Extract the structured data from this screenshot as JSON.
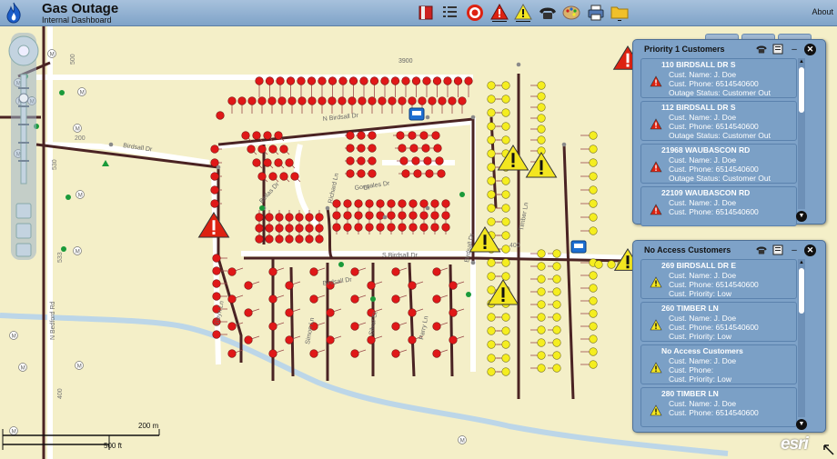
{
  "header": {
    "title": "Gas Outage",
    "subtitle": "Internal Dashboard",
    "about_label": "About"
  },
  "toolbar": [
    {
      "name": "layers-book-icon"
    },
    {
      "name": "list-icon"
    },
    {
      "name": "target-icon"
    },
    {
      "name": "red-alert-icon"
    },
    {
      "name": "yellow-alert-icon"
    },
    {
      "name": "phone-icon"
    },
    {
      "name": "palette-icon"
    },
    {
      "name": "printer-icon"
    },
    {
      "name": "folder-icon"
    }
  ],
  "map": {
    "streets": [
      "3900",
      "N Birdsall Dr",
      "Birdsall Dr",
      "Dr",
      "Richard Ln",
      "Bellas Dr",
      "Gonzales Dr",
      "S Birdsall Dr",
      "Timber Ln",
      "N Bedford Rd",
      "Birdsall Dr",
      "Gleyn Ln",
      "Simon Ln",
      "Silver St",
      "Parry Ln",
      "Birdsall Dr"
    ],
    "numbers": [
      "500",
      "200",
      "530",
      "400",
      "533",
      "400"
    ],
    "scale": {
      "metric": "200 m",
      "imperial": "500 ft"
    },
    "attribution": "esri",
    "meter_label": "M"
  },
  "priority_panel": {
    "title": "Priority 1 Customers",
    "customers": [
      {
        "address": "110 BIRDSALL DR S",
        "name": "Cust. Name: J. Doe",
        "phone": "Cust. Phone: 6514540600",
        "status": "Outage Status: Customer Out"
      },
      {
        "address": "112 BIRDSALL DR S",
        "name": "Cust. Name: J. Doe",
        "phone": "Cust. Phone: 6514540600",
        "status": "Outage Status: Customer Out"
      },
      {
        "address": "21968 WAUBASCON RD",
        "name": "Cust. Name: J. Doe",
        "phone": "Cust. Phone: 6514540600",
        "status": "Outage Status: Customer Out"
      },
      {
        "address": "22109 WAUBASCON RD",
        "name": "Cust. Name: J. Doe",
        "phone": "Cust. Phone: 6514540600",
        "status": ""
      }
    ]
  },
  "noaccess_panel": {
    "title": "No Access Customers",
    "customers": [
      {
        "address": "269 BIRDSALL DR E",
        "name": "Cust. Name: J. Doe",
        "phone": "Cust. Phone: 6514540600",
        "priority": "Cust. Priority: Low"
      },
      {
        "address": "260 TIMBER LN",
        "name": "Cust. Name: J. Doe",
        "phone": "Cust. Phone: 6514540600",
        "priority": "Cust. Priority: Low"
      },
      {
        "address": "No Access Customers",
        "name": "Cust. Name: J. Doe",
        "phone": "Cust. Phone:",
        "priority": "Cust. Priority: Low"
      },
      {
        "address": "280 TIMBER LN",
        "name": "Cust. Name: J. Doe",
        "phone": "Cust. Phone: 6514540600",
        "priority": ""
      }
    ]
  },
  "colors": {
    "header": "#8aa9cc",
    "map_bg": "#f4efc8",
    "outage_red": "#e01818",
    "noaccess_yellow": "#f5ee1f",
    "gas_main": "#4a2323",
    "panel": "#7ea2c8"
  }
}
